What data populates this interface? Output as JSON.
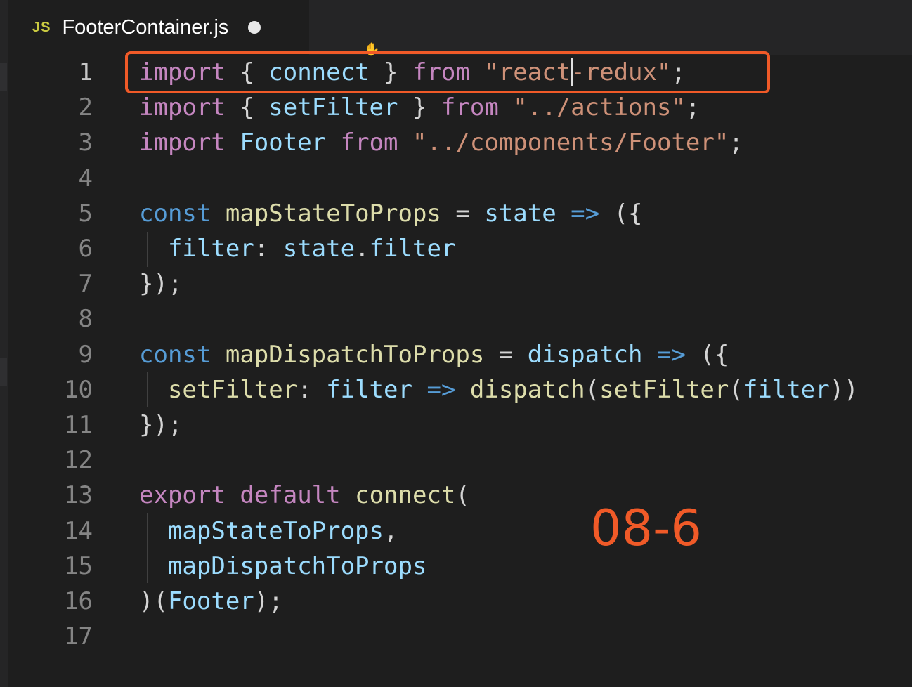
{
  "tab": {
    "icon": "JS",
    "filename": "FooterContainer.js",
    "dirty_indicator": "unsaved-dot-icon"
  },
  "badge": "08-6",
  "colors": {
    "keyword": "#c586c0",
    "string": "#ce9178",
    "variable": "#9cdcfe",
    "function": "#dcdcaa",
    "type": "#4ec9b0",
    "punctuation": "#d4d4d4",
    "storage": "#569cd6",
    "highlight_box": "#f05a28"
  },
  "lines": [
    {
      "num": "1",
      "tokens": [
        [
          "kw",
          "import"
        ],
        [
          "pn",
          " { "
        ],
        [
          "vr",
          "connect"
        ],
        [
          "pn",
          " } "
        ],
        [
          "kw",
          "from"
        ],
        [
          "pn",
          " "
        ],
        [
          "st",
          "\"react"
        ],
        [
          "st",
          "-redux\""
        ],
        [
          "pn",
          ";"
        ]
      ]
    },
    {
      "num": "2",
      "tokens": [
        [
          "kw",
          "import"
        ],
        [
          "pn",
          " { "
        ],
        [
          "vr",
          "setFilter"
        ],
        [
          "pn",
          " } "
        ],
        [
          "kw",
          "from"
        ],
        [
          "pn",
          " "
        ],
        [
          "st",
          "\"../actions\""
        ],
        [
          "pn",
          ";"
        ]
      ]
    },
    {
      "num": "3",
      "tokens": [
        [
          "kw",
          "import"
        ],
        [
          "pn",
          " "
        ],
        [
          "vr",
          "Footer"
        ],
        [
          "pn",
          " "
        ],
        [
          "kw",
          "from"
        ],
        [
          "pn",
          " "
        ],
        [
          "st",
          "\"../components/Footer\""
        ],
        [
          "pn",
          ";"
        ]
      ]
    },
    {
      "num": "4",
      "tokens": []
    },
    {
      "num": "5",
      "tokens": [
        [
          "sk",
          "const"
        ],
        [
          "pn",
          " "
        ],
        [
          "fn",
          "mapStateToProps"
        ],
        [
          "pn",
          " = "
        ],
        [
          "vr",
          "state"
        ],
        [
          "pn",
          " "
        ],
        [
          "sk",
          "=>"
        ],
        [
          "pn",
          " ({"
        ]
      ]
    },
    {
      "num": "6",
      "tokens": [
        [
          "pn",
          "  "
        ],
        [
          "vr",
          "filter"
        ],
        [
          "pn",
          ": "
        ],
        [
          "vr",
          "state"
        ],
        [
          "pn",
          "."
        ],
        [
          "vr",
          "filter"
        ]
      ]
    },
    {
      "num": "7",
      "tokens": [
        [
          "pn",
          "});"
        ]
      ]
    },
    {
      "num": "8",
      "tokens": []
    },
    {
      "num": "9",
      "tokens": [
        [
          "sk",
          "const"
        ],
        [
          "pn",
          " "
        ],
        [
          "fn",
          "mapDispatchToProps"
        ],
        [
          "pn",
          " = "
        ],
        [
          "vr",
          "dispatch"
        ],
        [
          "pn",
          " "
        ],
        [
          "sk",
          "=>"
        ],
        [
          "pn",
          " ({"
        ]
      ]
    },
    {
      "num": "10",
      "tokens": [
        [
          "pn",
          "  "
        ],
        [
          "fn",
          "setFilter"
        ],
        [
          "pn",
          ": "
        ],
        [
          "vr",
          "filter"
        ],
        [
          "pn",
          " "
        ],
        [
          "sk",
          "=>"
        ],
        [
          "pn",
          " "
        ],
        [
          "fn",
          "dispatch"
        ],
        [
          "pn",
          "("
        ],
        [
          "fn",
          "setFilter"
        ],
        [
          "pn",
          "("
        ],
        [
          "vr",
          "filter"
        ],
        [
          "pn",
          "))"
        ]
      ]
    },
    {
      "num": "11",
      "tokens": [
        [
          "pn",
          "});"
        ]
      ]
    },
    {
      "num": "12",
      "tokens": []
    },
    {
      "num": "13",
      "tokens": [
        [
          "kw",
          "export"
        ],
        [
          "pn",
          " "
        ],
        [
          "kw",
          "default"
        ],
        [
          "pn",
          " "
        ],
        [
          "fn",
          "connect"
        ],
        [
          "pn",
          "("
        ]
      ]
    },
    {
      "num": "14",
      "tokens": [
        [
          "pn",
          "  "
        ],
        [
          "vr",
          "mapStateToProps"
        ],
        [
          "pn",
          ","
        ]
      ]
    },
    {
      "num": "15",
      "tokens": [
        [
          "pn",
          "  "
        ],
        [
          "vr",
          "mapDispatchToProps"
        ]
      ]
    },
    {
      "num": "16",
      "tokens": [
        [
          "pn",
          ")("
        ],
        [
          "vr",
          "Footer"
        ],
        [
          "pn",
          ");"
        ]
      ]
    },
    {
      "num": "17",
      "tokens": []
    }
  ]
}
